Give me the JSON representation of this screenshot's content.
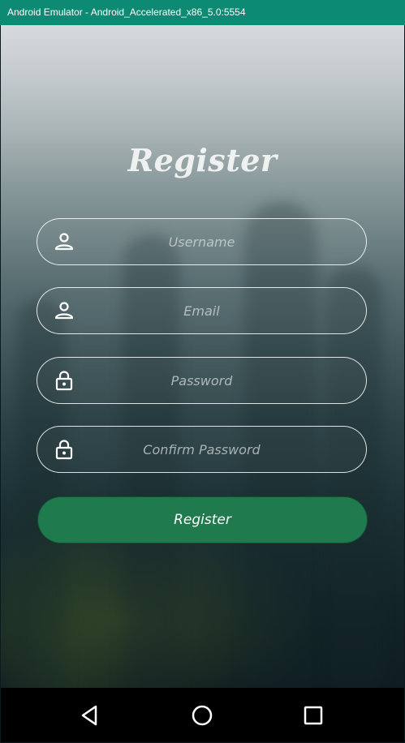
{
  "window": {
    "title": "Android Emulator - Android_Accelerated_x86_5.0:5554"
  },
  "screen": {
    "heading": "Register",
    "fields": [
      {
        "placeholder": "Username",
        "value": "",
        "icon": "person-icon"
      },
      {
        "placeholder": "Email",
        "value": "",
        "icon": "person-icon"
      },
      {
        "placeholder": "Password",
        "value": "",
        "icon": "lock-icon"
      },
      {
        "placeholder": "Confirm Password",
        "value": "",
        "icon": "lock-icon"
      }
    ],
    "register_button": "Register"
  },
  "navbar": {
    "buttons": [
      "back-icon",
      "home-icon",
      "recents-icon"
    ]
  },
  "colors": {
    "titlebar": "#0d8a73",
    "button": "#1f7a4e",
    "navbar": "#000000"
  }
}
